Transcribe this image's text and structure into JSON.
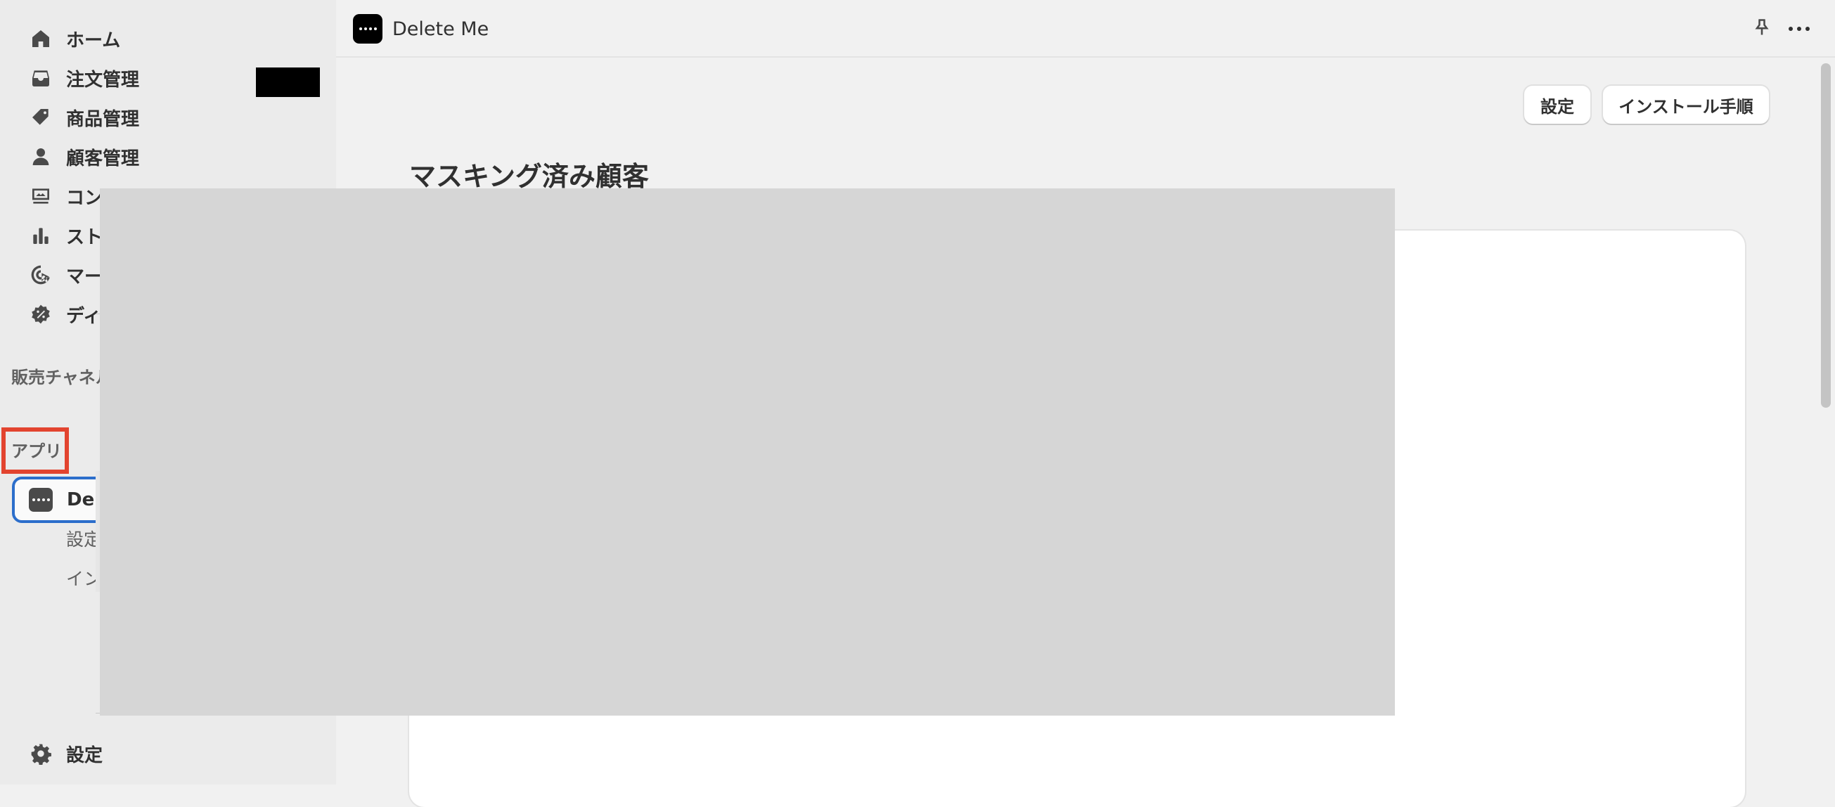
{
  "sidebar": {
    "nav": [
      {
        "label": "ホーム",
        "icon": "home-icon"
      },
      {
        "label": "注文管理",
        "icon": "inbox-icon"
      },
      {
        "label": "商品管理",
        "icon": "tag-icon"
      },
      {
        "label": "顧客管理",
        "icon": "person-icon"
      },
      {
        "label": "コンテンツ",
        "icon": "content-icon"
      },
      {
        "label": "ストア分析",
        "icon": "bar-chart-icon"
      },
      {
        "label": "マーケティング",
        "icon": "target-icon"
      },
      {
        "label": "ディスカウント",
        "icon": "discount-icon"
      }
    ],
    "sales_channels_label": "販売チャネル",
    "apps_label": "アプリ",
    "active_app": {
      "label": "Delete Me",
      "icon": "app-dots-icon"
    },
    "app_subitems": [
      "設定",
      "インストール手順"
    ],
    "settings_label": "設定"
  },
  "topbar": {
    "title": "Delete Me",
    "icons": [
      "pin-icon",
      "more-icon"
    ]
  },
  "main": {
    "buttons": {
      "settings": "設定",
      "install": "インストール手順"
    },
    "page_title": "マスキング済み顧客"
  },
  "colors": {
    "accent_border": "#2c6ecb",
    "highlight": "#e2442f",
    "sidebar_bg": "#ebebeb",
    "page_bg": "#f1f1f1"
  }
}
